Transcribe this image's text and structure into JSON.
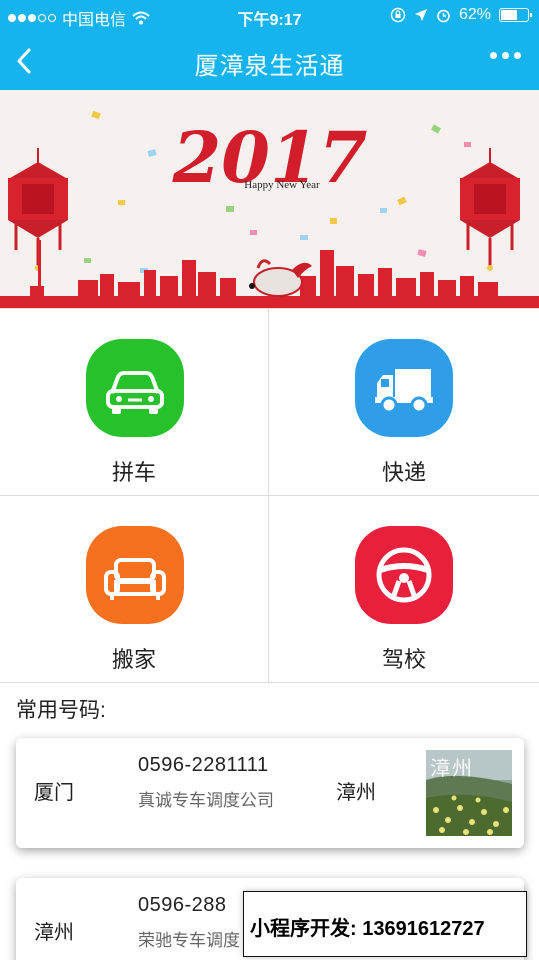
{
  "status_bar": {
    "carrier": "中国电信",
    "time": "下午9:17",
    "battery_percent": "62%",
    "battery_level": 0.62,
    "icons": [
      "signal-dots-icon",
      "wifi-icon",
      "lock-rotation-icon",
      "location-icon",
      "alarm-icon",
      "battery-icon"
    ]
  },
  "nav": {
    "title": "厦漳泉生活通",
    "back_icon": "chevron-left-icon",
    "more_icon": "more-dots-icon"
  },
  "banner": {
    "year_text": "2017",
    "greeting": "Happy New Year"
  },
  "services": [
    {
      "label": "拼车",
      "icon": "car-icon",
      "color": "#27c12c"
    },
    {
      "label": "快递",
      "icon": "truck-icon",
      "color": "#2f9de8"
    },
    {
      "label": "搬家",
      "icon": "sofa-icon",
      "color": "#f5701f"
    },
    {
      "label": "驾校",
      "icon": "steering-wheel-icon",
      "color": "#e8203c"
    }
  ],
  "common_numbers": {
    "title": "常用号码:",
    "items": [
      {
        "from": "厦门",
        "phone": "0596-2281111",
        "company": "真诚专车调度公司",
        "to": "漳州",
        "thumb_label": "漳州"
      },
      {
        "from": "漳州",
        "phone": "0596-288",
        "company": "荣驰专车调度",
        "to": "",
        "thumb_label": ""
      }
    ]
  },
  "dev_banner": {
    "text": "小程序开发:  13691612727"
  },
  "colors": {
    "brand_blue": "#15b4ee",
    "banner_red": "#d21e2b"
  }
}
